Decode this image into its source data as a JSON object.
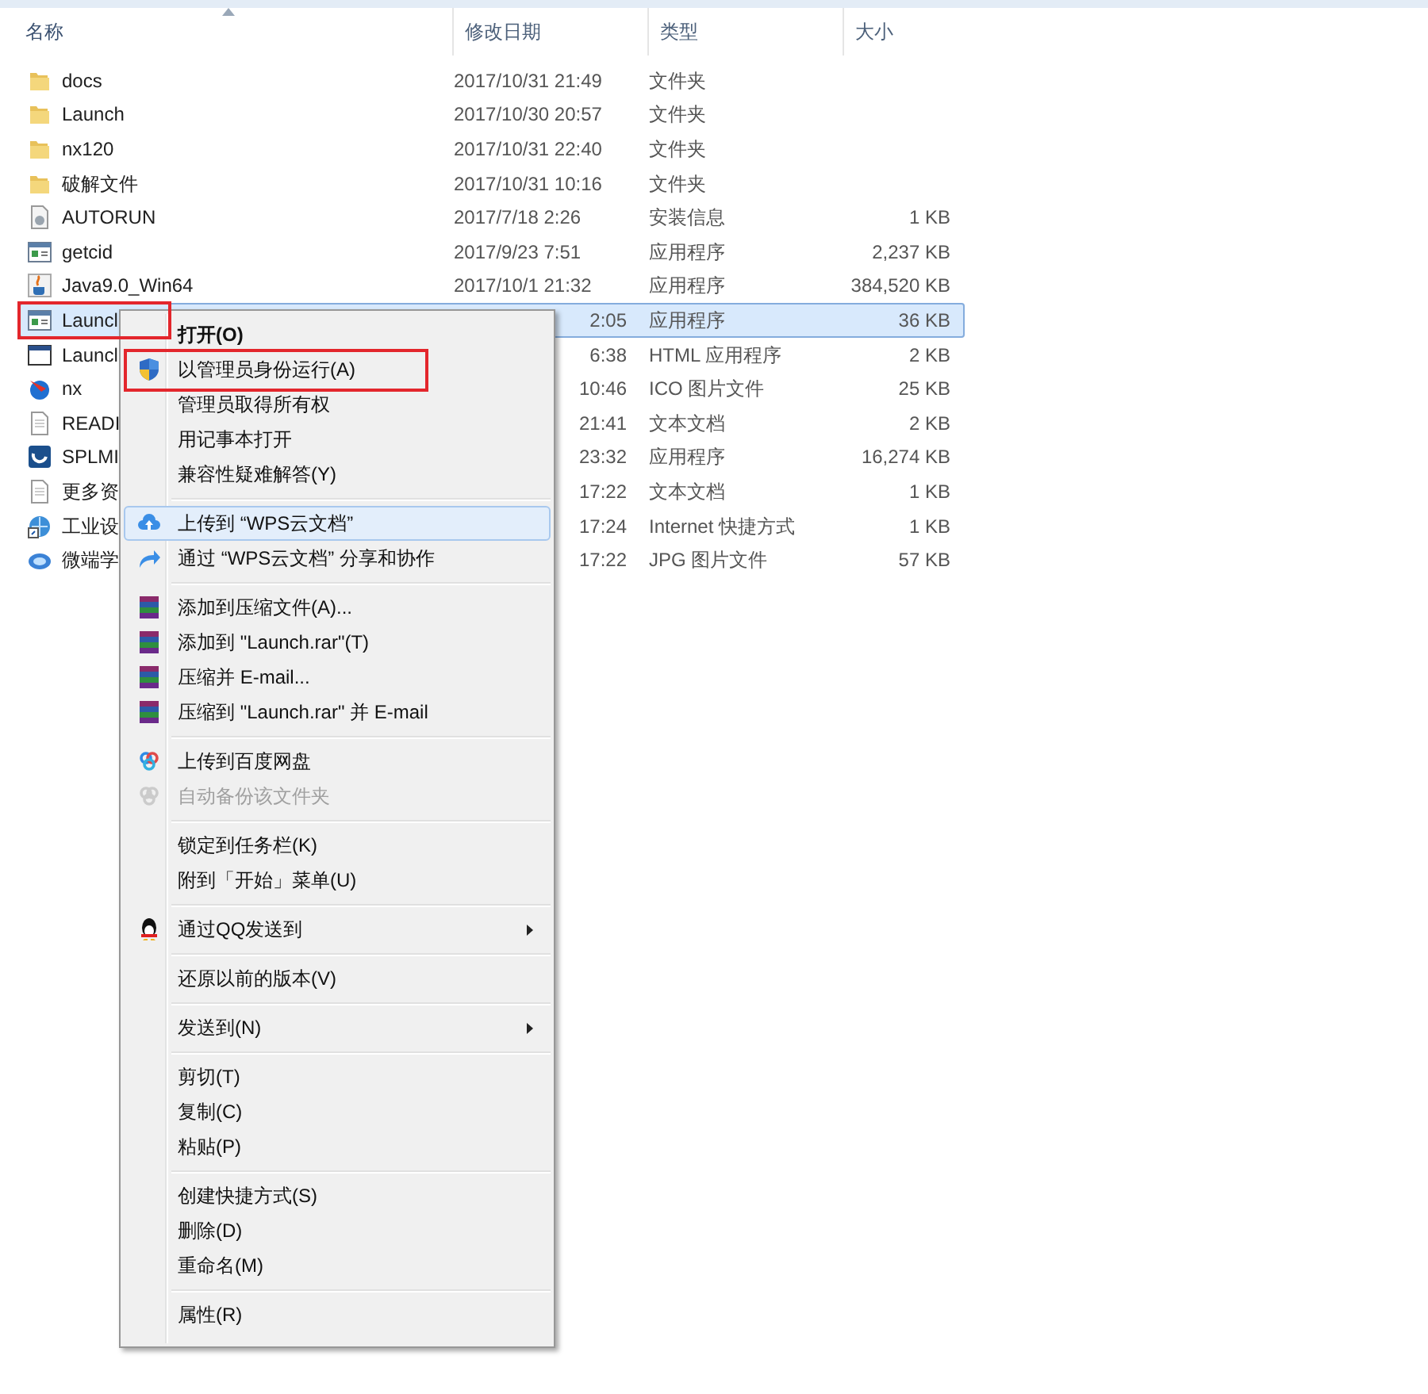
{
  "columns": [
    {
      "label": "名称",
      "sorted": true
    },
    {
      "label": "修改日期",
      "sorted": false
    },
    {
      "label": "类型",
      "sorted": false
    },
    {
      "label": "大小",
      "sorted": false
    }
  ],
  "files": [
    {
      "kind": "folder",
      "name": "docs",
      "date": "2017/10/31 21:49",
      "type": "文件夹",
      "selected": false,
      "annotated": false
    },
    {
      "kind": "folder",
      "name": "Launch",
      "date": "2017/10/30 20:57",
      "type": "文件夹",
      "selected": false,
      "annotated": false
    },
    {
      "kind": "folder",
      "name": "nx120",
      "date": "2017/10/31 22:40",
      "type": "文件夹",
      "selected": false,
      "annotated": false
    },
    {
      "kind": "folder",
      "name": "破解文件",
      "date": "2017/10/31 10:16",
      "type": "文件夹",
      "selected": false,
      "annotated": false
    },
    {
      "kind": "setup",
      "name": "AUTORUN",
      "date": "2017/7/18 2:26",
      "type": "安装信息",
      "size": "1 KB",
      "selected": false,
      "annotated": false
    },
    {
      "kind": "app",
      "name": "getcid",
      "date": "2017/9/23 7:51",
      "type": "应用程序",
      "size": "2,237 KB",
      "selected": false,
      "annotated": false
    },
    {
      "kind": "java",
      "name": "Java9.0_Win64",
      "date": "2017/10/1 21:32",
      "type": "应用程序",
      "size": "384,520 KB",
      "selected": false,
      "annotated": false
    },
    {
      "kind": "app",
      "name": "Launcl",
      "date": "2:05",
      "type": "应用程序",
      "size": "36 KB",
      "selected": true,
      "annotated": true
    },
    {
      "kind": "window",
      "name": "Launcl",
      "date": "6:38",
      "type": "HTML 应用程序",
      "size": "2 KB",
      "selected": false,
      "annotated": false
    },
    {
      "kind": "orb",
      "name": "nx",
      "date": "10:46",
      "type": "ICO 图片文件",
      "size": "25 KB",
      "selected": false,
      "annotated": false
    },
    {
      "kind": "text",
      "name": "READI",
      "date": "21:41",
      "type": "文本文档",
      "size": "2 KB",
      "selected": false,
      "annotated": false
    },
    {
      "kind": "logo",
      "name": "SPLMI",
      "date": "23:32",
      "type": "应用程序",
      "size": "16,274 KB",
      "selected": false,
      "annotated": false
    },
    {
      "kind": "text",
      "name": "更多资",
      "date": "17:22",
      "type": "文本文档",
      "size": "1 KB",
      "selected": false,
      "annotated": false
    },
    {
      "kind": "web",
      "name": "工业设",
      "date": "17:24",
      "type": "Internet 快捷方式",
      "size": "1 KB",
      "selected": false,
      "annotated": false
    },
    {
      "kind": "image",
      "name": "微端学",
      "date": "17:22",
      "type": "JPG 图片文件",
      "size": "57 KB",
      "selected": false,
      "annotated": false
    }
  ],
  "menu": [
    {
      "kind": "plain",
      "label": "打开(O)",
      "default": true,
      "disabled": false,
      "hovered": false,
      "submenu": false,
      "annotated": false
    },
    {
      "kind": "shield",
      "label": "以管理员身份运行(A)",
      "default": false,
      "disabled": false,
      "hovered": false,
      "submenu": false,
      "annotated": true
    },
    {
      "kind": "plain",
      "label": "管理员取得所有权",
      "default": false,
      "disabled": false,
      "hovered": false,
      "submenu": false,
      "annotated": false
    },
    {
      "kind": "plain",
      "label": "用记事本打开",
      "default": false,
      "disabled": false,
      "hovered": false,
      "submenu": false,
      "annotated": false
    },
    {
      "kind": "plain",
      "label": "兼容性疑难解答(Y)",
      "default": false,
      "disabled": false,
      "hovered": false,
      "submenu": false,
      "annotated": false
    },
    {
      "kind": "separator"
    },
    {
      "kind": "cloud",
      "label": "上传到 “WPS云文档”",
      "default": false,
      "disabled": false,
      "hovered": true,
      "submenu": false,
      "annotated": false
    },
    {
      "kind": "share",
      "label": "通过 “WPS云文档” 分享和协作",
      "default": false,
      "disabled": false,
      "hovered": false,
      "submenu": false,
      "annotated": false
    },
    {
      "kind": "separator"
    },
    {
      "kind": "archive",
      "label": "添加到压缩文件(A)...",
      "default": false,
      "disabled": false,
      "hovered": false,
      "submenu": false,
      "annotated": false
    },
    {
      "kind": "archive",
      "label": "添加到 \"Launch.rar\"(T)",
      "default": false,
      "disabled": false,
      "hovered": false,
      "submenu": false,
      "annotated": false
    },
    {
      "kind": "archive",
      "label": "压缩并 E-mail...",
      "default": false,
      "disabled": false,
      "hovered": false,
      "submenu": false,
      "annotated": false
    },
    {
      "kind": "archive",
      "label": "压缩到 \"Launch.rar\" 并 E-mail",
      "default": false,
      "disabled": false,
      "hovered": false,
      "submenu": false,
      "annotated": false
    },
    {
      "kind": "separator"
    },
    {
      "kind": "rings",
      "label": "上传到百度网盘",
      "default": false,
      "disabled": false,
      "hovered": false,
      "submenu": false,
      "annotated": false
    },
    {
      "kind": "rings",
      "label": "自动备份该文件夹",
      "default": false,
      "disabled": true,
      "hovered": false,
      "submenu": false,
      "annotated": false
    },
    {
      "kind": "separator"
    },
    {
      "kind": "plain",
      "label": "锁定到任务栏(K)",
      "default": false,
      "disabled": false,
      "hovered": false,
      "submenu": false,
      "annotated": false
    },
    {
      "kind": "plain",
      "label": "附到「开始」菜单(U)",
      "default": false,
      "disabled": false,
      "hovered": false,
      "submenu": false,
      "annotated": false
    },
    {
      "kind": "separator"
    },
    {
      "kind": "penguin",
      "label": "通过QQ发送到",
      "default": false,
      "disabled": false,
      "hovered": false,
      "submenu": true,
      "annotated": false
    },
    {
      "kind": "separator"
    },
    {
      "kind": "plain",
      "label": "还原以前的版本(V)",
      "default": false,
      "disabled": false,
      "hovered": false,
      "submenu": false,
      "annotated": false
    },
    {
      "kind": "separator"
    },
    {
      "kind": "plain",
      "label": "发送到(N)",
      "default": false,
      "disabled": false,
      "hovered": false,
      "submenu": true,
      "annotated": false
    },
    {
      "kind": "separator"
    },
    {
      "kind": "plain",
      "label": "剪切(T)",
      "default": false,
      "disabled": false,
      "hovered": false,
      "submenu": false,
      "annotated": false
    },
    {
      "kind": "plain",
      "label": "复制(C)",
      "default": false,
      "disabled": false,
      "hovered": false,
      "submenu": false,
      "annotated": false
    },
    {
      "kind": "plain",
      "label": "粘贴(P)",
      "default": false,
      "disabled": false,
      "hovered": false,
      "submenu": false,
      "annotated": false
    },
    {
      "kind": "separator"
    },
    {
      "kind": "plain",
      "label": "创建快捷方式(S)",
      "default": false,
      "disabled": false,
      "hovered": false,
      "submenu": false,
      "annotated": false
    },
    {
      "kind": "plain",
      "label": "删除(D)",
      "default": false,
      "disabled": false,
      "hovered": false,
      "submenu": false,
      "annotated": false
    },
    {
      "kind": "plain",
      "label": "重命名(M)",
      "default": false,
      "disabled": false,
      "hovered": false,
      "submenu": false,
      "annotated": false
    },
    {
      "kind": "separator"
    },
    {
      "kind": "plain",
      "label": "属性(R)",
      "default": false,
      "disabled": false,
      "hovered": false,
      "submenu": false,
      "annotated": false
    }
  ]
}
